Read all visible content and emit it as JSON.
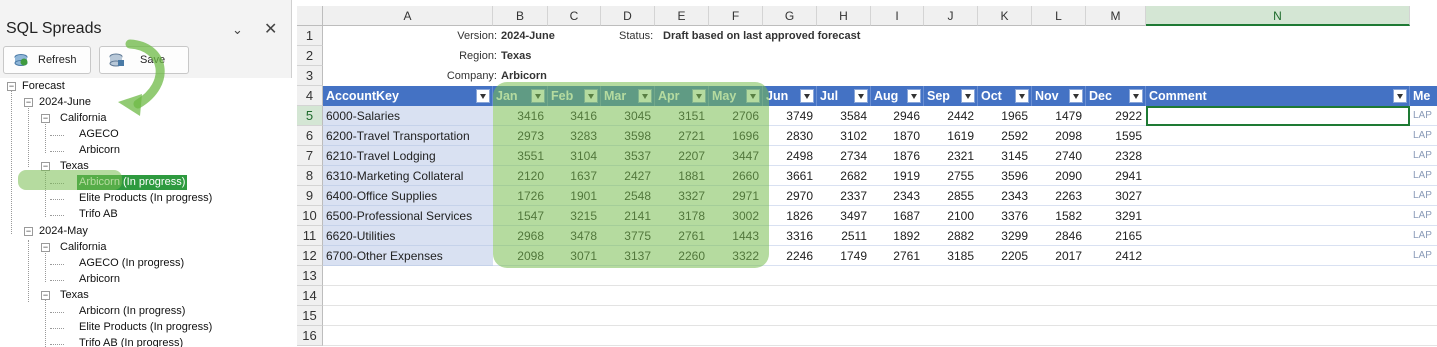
{
  "pane": {
    "title": "SQL Spreads",
    "refresh_label": "Refresh",
    "save_label": "Save"
  },
  "tree": {
    "root": "Forecast",
    "period1": "2024-June",
    "p1_region1": "California",
    "p1_r1_c1": "AGECO",
    "p1_r1_c2": "Arbicorn",
    "p1_region2": "Texas",
    "p1_r2_c1": "Arbicorn (In progress)",
    "p1_r2_c2": "Elite Products (In progress)",
    "p1_r2_c3": "Trifo AB",
    "period2": "2024-May",
    "p2_region1": "California",
    "p2_r1_c1": "AGECO (In progress)",
    "p2_r1_c2": "Arbicorn",
    "p2_region2": "Texas",
    "p2_r2_c1": "Arbicorn (In progress)",
    "p2_r2_c2": "Elite Products (In progress)",
    "p2_r2_c3": "Trifo AB (In progress)"
  },
  "sheet": {
    "columns": [
      "A",
      "B",
      "C",
      "D",
      "E",
      "F",
      "G",
      "H",
      "I",
      "J",
      "K",
      "L",
      "M",
      "N"
    ],
    "rows": [
      "1",
      "2",
      "3",
      "4",
      "5",
      "6",
      "7",
      "8",
      "9",
      "10",
      "11",
      "12",
      "13",
      "14",
      "15",
      "16"
    ],
    "version_label": "Version:",
    "version_value": "2024-June",
    "status_label": "Status:",
    "status_value": "Draft based on last approved forecast",
    "region_label": "Region:",
    "region_value": "Texas",
    "company_label": "Company:",
    "company_value": "Arbicorn",
    "headers": [
      "AccountKey",
      "Jan",
      "Feb",
      "Mar",
      "Apr",
      "May",
      "Jun",
      "Jul",
      "Aug",
      "Sep",
      "Oct",
      "Nov",
      "Dec",
      "Comment",
      "Me"
    ],
    "accounts": [
      "6000-Salaries",
      "6200-Travel Transportation",
      "6210-Travel Lodging",
      "6310-Marketing Collateral",
      "6400-Office Supplies",
      "6500-Professional Services",
      "6620-Utilities",
      "6700-Other Expenses"
    ],
    "values": [
      [
        "3416",
        "3416",
        "3045",
        "3151",
        "2706",
        "3749",
        "3584",
        "2946",
        "2442",
        "1965",
        "1479",
        "2922"
      ],
      [
        "2973",
        "3283",
        "3598",
        "2721",
        "1696",
        "2830",
        "3102",
        "1870",
        "1619",
        "2592",
        "2098",
        "1595"
      ],
      [
        "3551",
        "3104",
        "3537",
        "2207",
        "3447",
        "2498",
        "2734",
        "1876",
        "2321",
        "3145",
        "2740",
        "2328"
      ],
      [
        "2120",
        "1637",
        "2427",
        "1881",
        "2660",
        "3661",
        "2682",
        "1919",
        "2755",
        "3596",
        "2090",
        "2941"
      ],
      [
        "1726",
        "1901",
        "2548",
        "3327",
        "2971",
        "2970",
        "2337",
        "2343",
        "2855",
        "2343",
        "2263",
        "3027"
      ],
      [
        "1547",
        "3215",
        "2141",
        "3178",
        "3002",
        "1826",
        "3497",
        "1687",
        "2100",
        "3376",
        "1582",
        "3291"
      ],
      [
        "2968",
        "3478",
        "3775",
        "2761",
        "1443",
        "3316",
        "2511",
        "1892",
        "2882",
        "3299",
        "2846",
        "2165"
      ],
      [
        "2098",
        "3071",
        "3137",
        "2260",
        "3322",
        "2246",
        "1749",
        "2761",
        "3185",
        "2205",
        "2017",
        "2412"
      ]
    ],
    "me_values": [
      "LAP",
      "LAP",
      "LAP",
      "LAP",
      "LAP",
      "LAP",
      "LAP",
      "LAP"
    ],
    "colors": {
      "header_bg": "#4472c4",
      "account_bg": "#d9e1f2",
      "highlight": "#78be50",
      "selected_node": "#2e9a3f"
    }
  }
}
